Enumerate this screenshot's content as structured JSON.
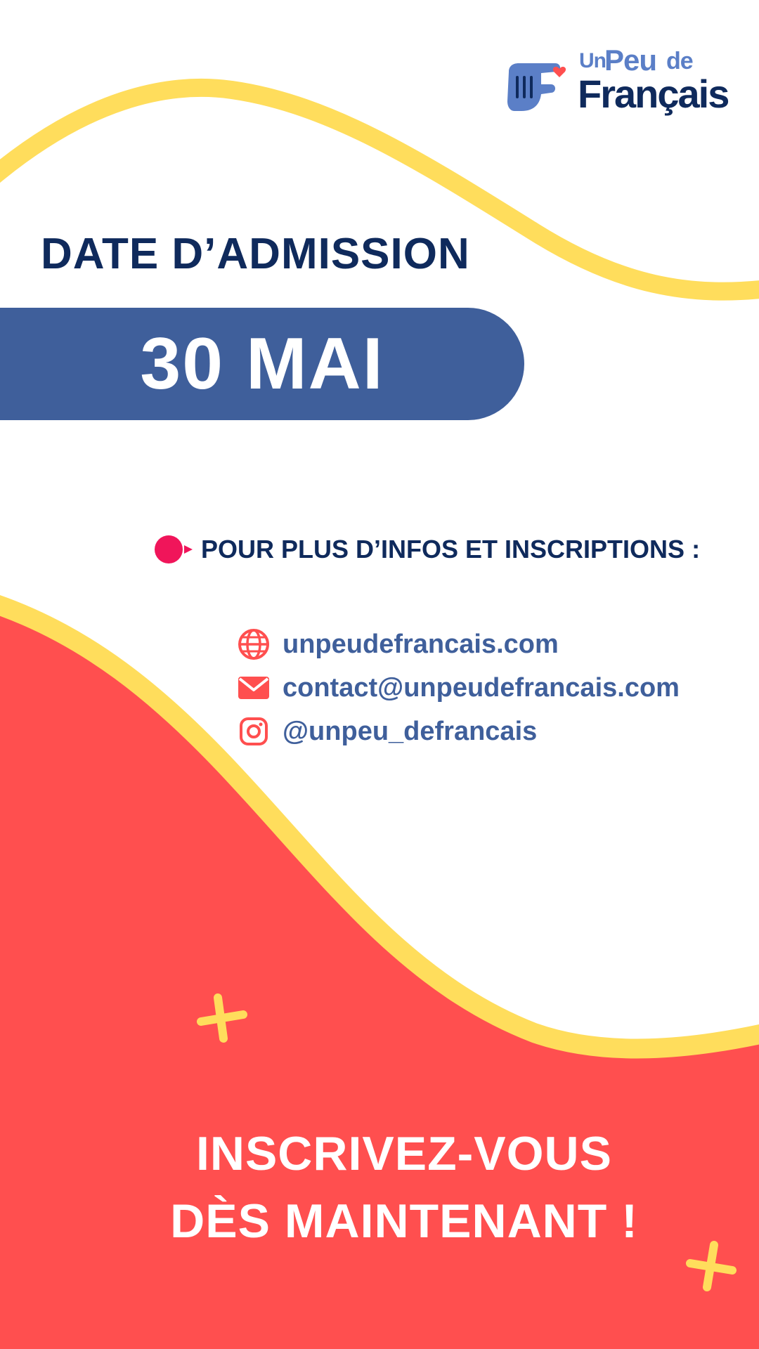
{
  "brand": {
    "logo_un": "Un",
    "logo_peu": "Peu",
    "logo_de": "de",
    "logo_francais": "Français"
  },
  "admission": {
    "title": "DATE D’ADMISSION",
    "date": "30 MAI"
  },
  "info": {
    "heading": "POUR PLUS D’INFOS ET INSCRIPTIONS :",
    "contacts": [
      {
        "icon": "globe-icon",
        "text": "unpeudefrancais.com"
      },
      {
        "icon": "mail-icon",
        "text": "contact@unpeudefrancais.com"
      },
      {
        "icon": "instagram-icon",
        "text": "@unpeu_defrancais"
      }
    ]
  },
  "cta": {
    "line1": "INSCRIVEZ-VOUS",
    "line2": "DÈS MAINTENANT !"
  },
  "colors": {
    "navy": "#0f2a5c",
    "blue": "#3f5f9b",
    "logo_blue": "#5b7fc7",
    "yellow": "#ffdd5c",
    "red": "#ff4f4f",
    "pink": "#f0155a",
    "white": "#ffffff"
  }
}
